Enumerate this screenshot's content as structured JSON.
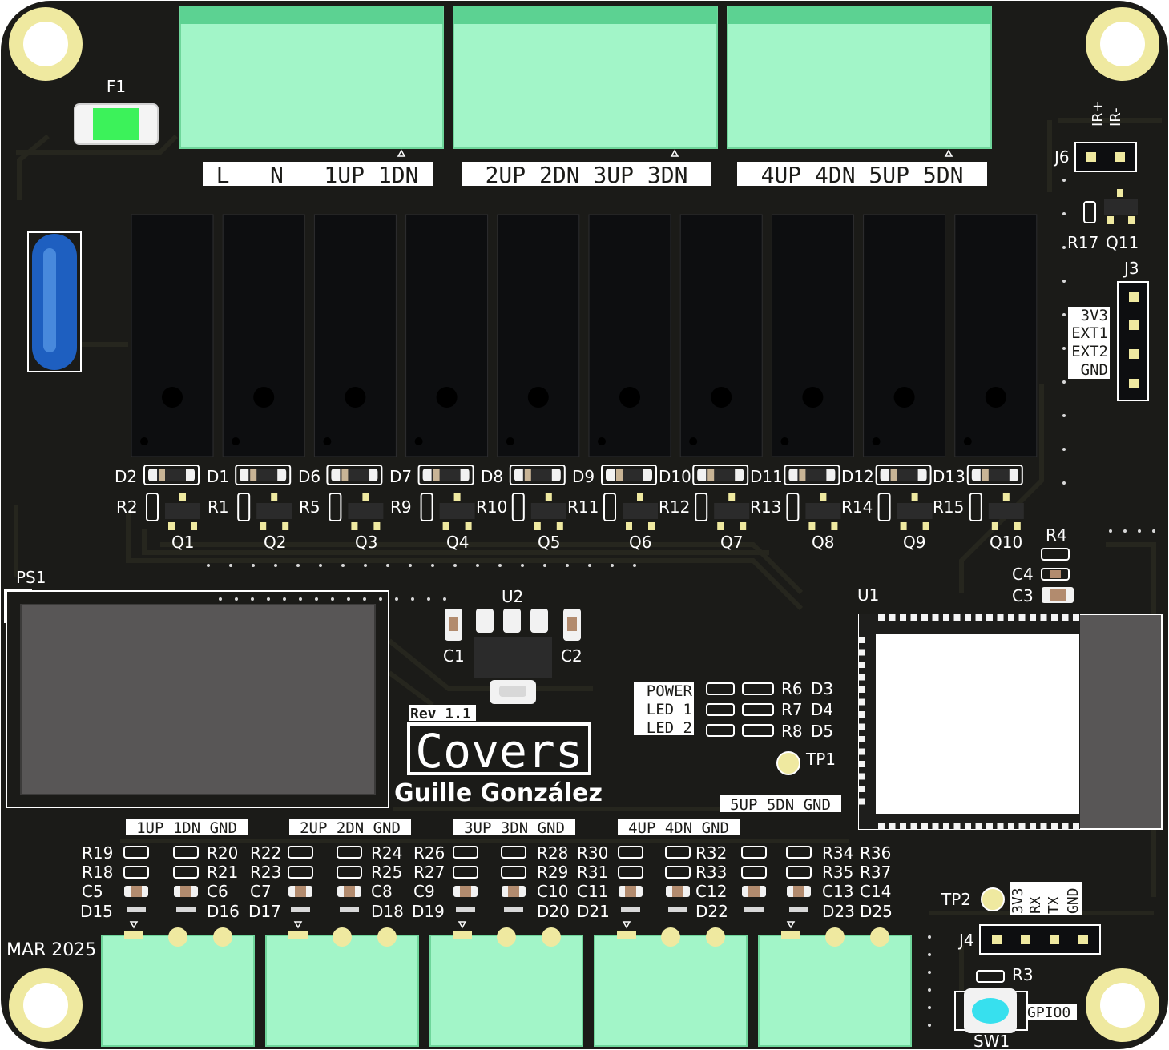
{
  "colors": {
    "board": "#1b1b18",
    "trace": "#2a2a1f",
    "copper_pad": "#efe9a0",
    "terminal": "#a2f5c8",
    "terminal_top": "#5cd292",
    "relay": "#0d0e10",
    "silk": "#ffffff",
    "fuse_green": "#3cf25a",
    "capacitor_blue": "#1e5fc0",
    "button_cyan": "#37e0ee",
    "module_grey": "#585656"
  },
  "board": {
    "name": "Covers",
    "revision": "Rev 1.1",
    "author": "Guille González",
    "date": "MAR 2025"
  },
  "top_terminals": {
    "labels": [
      "L   N   1UP 1DN",
      "2UP 2DN 3UP 3DN",
      "4UP 4DN 5UP 5DN"
    ]
  },
  "fuse": {
    "ref": "F1"
  },
  "relays": {
    "diode_refs": [
      "D2",
      "D1",
      "D6",
      "D7",
      "D8",
      "D9",
      "D10",
      "D11",
      "D12",
      "D13"
    ],
    "resistor_refs": [
      "R2",
      "R1",
      "R5",
      "R9",
      "R10",
      "R11",
      "R12",
      "R13",
      "R14",
      "R15"
    ],
    "transistor_refs": [
      "Q1",
      "Q2",
      "Q3",
      "Q4",
      "Q5",
      "Q6",
      "Q7",
      "Q8",
      "Q9",
      "Q10"
    ]
  },
  "ir": {
    "ir_plus": "IR+",
    "ir_minus": "IR-",
    "j6": "J6",
    "r17": "R17",
    "q11": "Q11"
  },
  "j3": {
    "ref": "J3",
    "pins": [
      "3V3",
      "EXT1",
      "EXT2",
      "GND"
    ]
  },
  "ps1": {
    "ref": "PS1"
  },
  "regulator": {
    "ref": "U2",
    "c1": "C1",
    "c2": "C2"
  },
  "leds": {
    "labels": [
      "POWER",
      "LED 1",
      "LED 2"
    ],
    "resistors": [
      "R6",
      "R7",
      "R8"
    ],
    "diodes": [
      "D3",
      "D4",
      "D5"
    ]
  },
  "tp1": "TP1",
  "tp2": "TP2",
  "module": {
    "ref": "U1",
    "r4": "R4",
    "c4": "C4",
    "c3": "C3",
    "label_5": "5UP 5DN GND"
  },
  "bottom": {
    "group_labels": [
      "1UP 1DN GND",
      "2UP 2DN GND",
      "3UP 3DN GND",
      "4UP 4DN GND"
    ],
    "row1_refs": [
      "R19",
      "R20",
      "R22",
      "R24",
      "R26",
      "R28",
      "R30",
      "R32",
      "R34",
      "R36"
    ],
    "row2_refs": [
      "R18",
      "R21",
      "R23",
      "R25",
      "R27",
      "R29",
      "R31",
      "R33",
      "R35",
      "R37"
    ],
    "row3_refs": [
      "C5",
      "C6",
      "C7",
      "C8",
      "C9",
      "C10",
      "C11",
      "C12",
      "C13",
      "C14"
    ],
    "row4_refs": [
      "D15",
      "D16",
      "D17",
      "D18",
      "D19",
      "D20",
      "D21",
      "D22",
      "D23",
      "D25"
    ]
  },
  "serial": {
    "ref": "J4",
    "pins": [
      "3V3",
      "RX",
      "TX",
      "GND"
    ],
    "r3": "R3"
  },
  "button": {
    "ref": "SW1",
    "label": "GPIO0"
  }
}
